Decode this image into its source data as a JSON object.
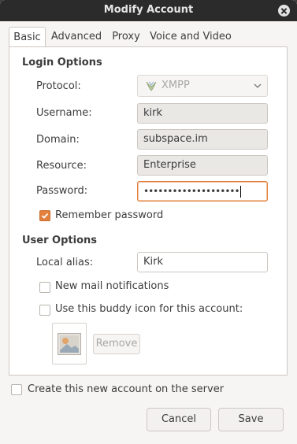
{
  "window": {
    "title": "Modify Account"
  },
  "tabs": [
    {
      "label": "Basic",
      "active": true
    },
    {
      "label": "Advanced",
      "active": false
    },
    {
      "label": "Proxy",
      "active": false
    },
    {
      "label": "Voice and Video",
      "active": false
    }
  ],
  "login_options": {
    "heading": "Login Options",
    "protocol": {
      "label": "Protocol:",
      "value": "XMPP",
      "icon": "xmpp-icon"
    },
    "username": {
      "label": "Username:",
      "value": "kirk"
    },
    "domain": {
      "label": "Domain:",
      "value": "subspace.im"
    },
    "resource": {
      "label": "Resource:",
      "value": "Enterprise"
    },
    "password": {
      "label": "Password:",
      "value": "••••••••••••••••••••"
    },
    "remember_password": {
      "label": "Remember password",
      "checked": true
    }
  },
  "user_options": {
    "heading": "User Options",
    "local_alias": {
      "label": "Local alias:",
      "value": "Kirk"
    },
    "new_mail": {
      "label": "New mail notifications",
      "checked": false
    },
    "buddy_icon": {
      "label": "Use this buddy icon for this account:",
      "checked": false
    },
    "remove_label": "Remove"
  },
  "create_account": {
    "label": "Create this new account on the server",
    "checked": false
  },
  "buttons": {
    "cancel": "Cancel",
    "save": "Save"
  },
  "colors": {
    "accent": "#e3803c",
    "titlebar": "#2b2b2b",
    "panel": "#ffffff",
    "window_bg": "#f6f5f4"
  }
}
